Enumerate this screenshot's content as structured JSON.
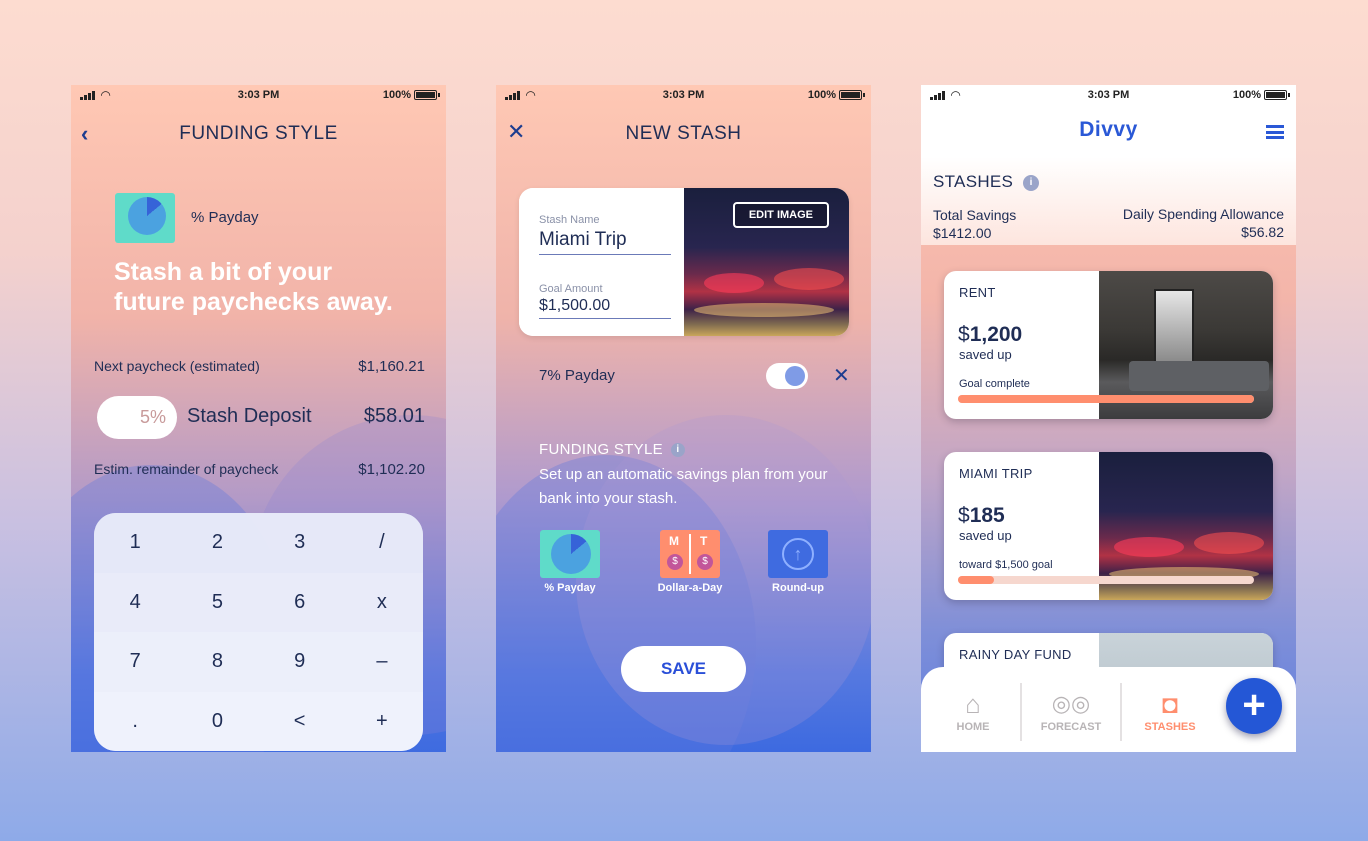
{
  "status_bar": {
    "time": "3:03 PM",
    "battery": "100%"
  },
  "screen1": {
    "title": "FUNDING STYLE",
    "back_icon": "chevron-left-icon",
    "method_label": "% Payday",
    "headline_1": "Stash a bit of your",
    "headline_2": "future paychecks away.",
    "next_paycheck_label": "Next paycheck (estimated)",
    "next_paycheck_value": "$1,160.21",
    "percent": "5%",
    "deposit_label": "Stash Deposit",
    "deposit_value": "$58.01",
    "remainder_label": "Estim. remainder of paycheck",
    "remainder_value": "$1,102.20",
    "keys": [
      "1",
      "2",
      "3",
      "/",
      "4",
      "5",
      "6",
      "x",
      "7",
      "8",
      "9",
      "–",
      ".",
      "0",
      "<",
      "+"
    ]
  },
  "screen2": {
    "title": "NEW STASH",
    "close_icon": "close-icon",
    "stash_name_label": "Stash Name",
    "stash_name_value": "Miami Trip",
    "goal_label": "Goal Amount",
    "goal_value": "$1,500.00",
    "edit_image": "EDIT IMAGE",
    "funding_item": "7% Payday",
    "funding_style_title": "FUNDING STYLE",
    "funding_style_desc": "Set up an automatic savings plan from your bank into your stash.",
    "options": [
      {
        "label": "% Payday",
        "color": "#5fdbc9"
      },
      {
        "label": "Dollar-a-Day",
        "color": "#ff8e6e",
        "letters": [
          "M",
          "T"
        ]
      },
      {
        "label": "Round-up",
        "color": "#3f6be0"
      }
    ],
    "save": "SAVE"
  },
  "screen3": {
    "logo": "Divvy",
    "section": "STASHES",
    "total_savings_label": "Total Savings",
    "total_savings_value": "$1412.00",
    "allowance_label": "Daily Spending Allowance",
    "allowance_value": "$56.82",
    "stashes": [
      {
        "name": "RENT",
        "currency": "$",
        "amount": "1,200",
        "sub": "saved up",
        "note": "Goal complete",
        "progress": 1.0
      },
      {
        "name": "MIAMI TRIP",
        "currency": "$",
        "amount": "185",
        "sub": "saved up",
        "note": "toward $1,500 goal",
        "progress": 0.12
      },
      {
        "name": "RAINY DAY FUND"
      }
    ],
    "tabs": [
      {
        "label": "HOME",
        "icon": "home-icon"
      },
      {
        "label": "FORECAST",
        "icon": "binoculars-icon"
      },
      {
        "label": "STASHES",
        "icon": "piggy-bank-icon"
      }
    ],
    "colors": {
      "accent": "#2a58d6",
      "active_tab": "#ff8e6e",
      "progress": "#ff8e6e"
    }
  }
}
